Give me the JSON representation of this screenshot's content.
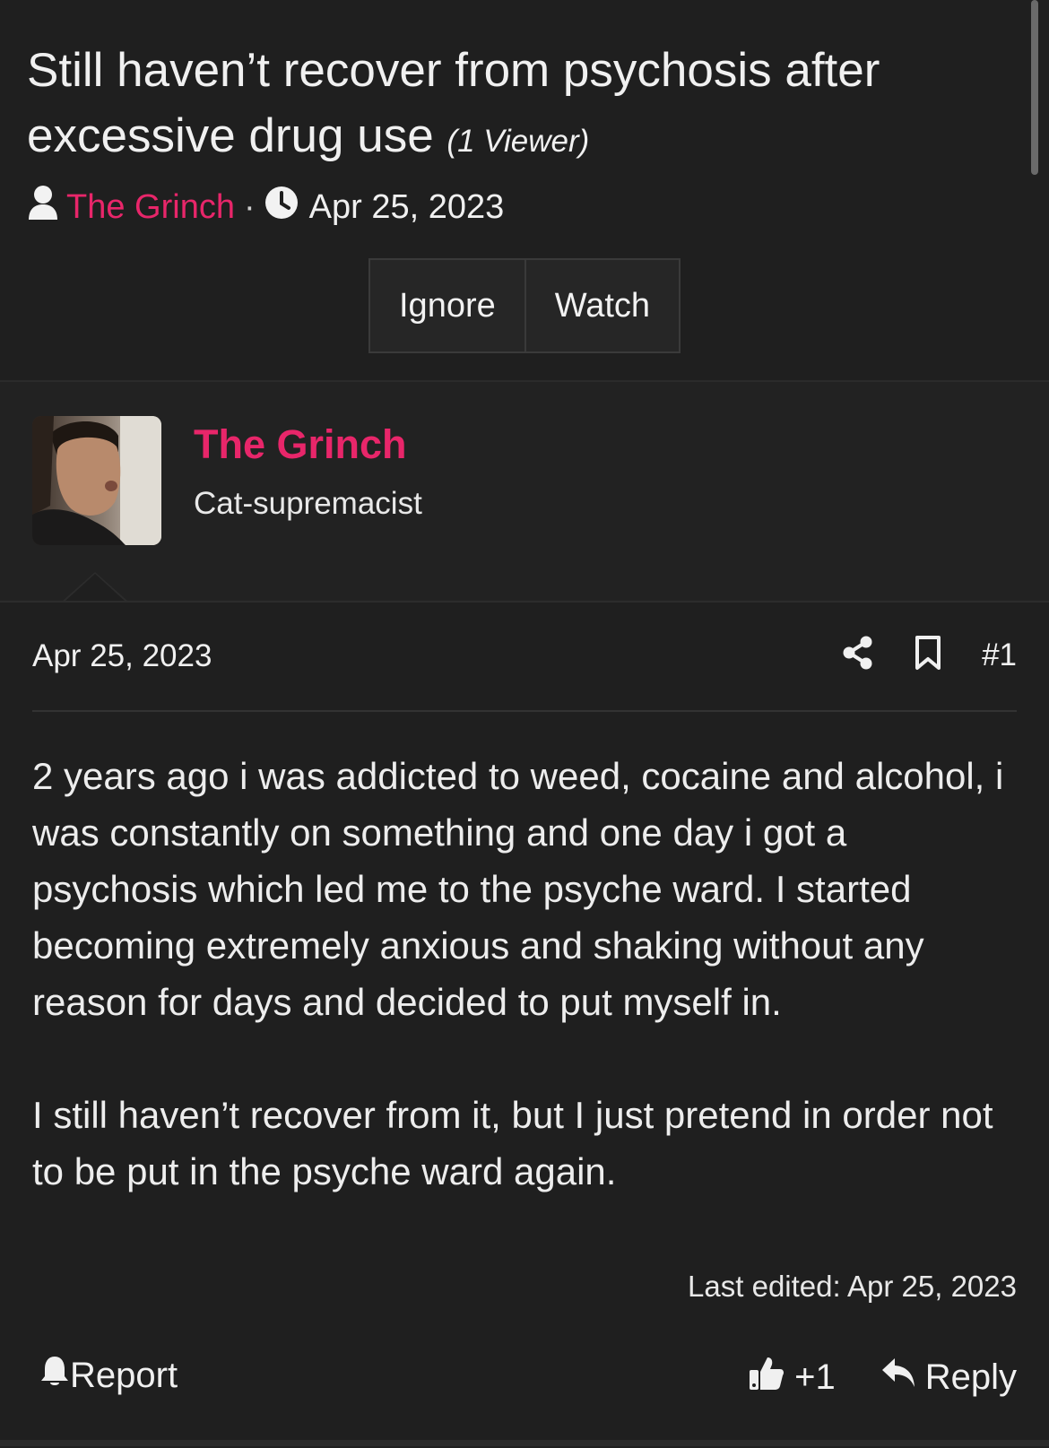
{
  "thread": {
    "title": "Still haven’t recover from psychosis after excessive drug use",
    "viewer_note": "(1 Viewer)",
    "author": "The Grinch",
    "separator": "·",
    "date": "Apr 25, 2023",
    "buttons": {
      "ignore": "Ignore",
      "watch": "Watch"
    }
  },
  "user": {
    "name": "The Grinch",
    "title": "Cat-supremacist"
  },
  "post": {
    "date": "Apr 25, 2023",
    "number": "#1",
    "paragraphs": [
      "2 years ago i was addicted to weed, cocaine and alcohol, i was constantly on something and one day i got a psychosis which led me to the psyche ward. I started becoming extremely anxious and shaking without any reason for days and decided to put myself in.",
      "I still haven’t recover from it, but I just pretend in order not to be put in the psyche ward again."
    ],
    "last_edited": "Last edited: Apr 25, 2023"
  },
  "footer": {
    "report": "Report",
    "reaction_count": "+1",
    "reply": "Reply"
  },
  "colors": {
    "background": "#1f1f1f",
    "accent": "#e8266a",
    "text": "#ececec"
  },
  "icons": [
    "user-icon",
    "clock-icon",
    "share-icon",
    "bookmark-icon",
    "bell-icon",
    "thumbs-up-icon",
    "reply-icon"
  ]
}
